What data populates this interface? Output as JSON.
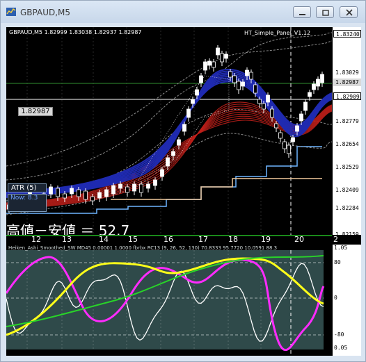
{
  "window": {
    "title": "GBPAUD,M5"
  },
  "chart_header": {
    "symbol_text": "GBPAUD,M5  1.82999 1.83038 1.82937 1.82987",
    "indicator_name": "HT_Simple_Panel_V1.12"
  },
  "price_scale": {
    "labels": [
      "1.83240",
      "1.83029",
      "1.82987",
      "1.82909",
      "1.82779",
      "1.82654",
      "1.82529",
      "1.82409",
      "1.82284",
      "1.82159"
    ]
  },
  "bid_tag": "1.82987",
  "atr_panel": {
    "label": "ATR (5)",
    "value_text": "Now: 8.3"
  },
  "overlay_text": "高値－安値 ＝ 52.7",
  "time_axis": {
    "labels": [
      "12",
      "13",
      "14",
      "15",
      "16",
      "17",
      "18",
      "19",
      "20",
      "2"
    ]
  },
  "sub_window": {
    "header": "Heiken_Ashi_Smoothed_SW  MD45 0.00001  1.0000  fbrbx  RC13 (9, 26, 52, 130) 70.8333 95.7720 10.0591 88.3",
    "scale_labels": [
      "1.05",
      "80",
      "0",
      "-80",
      "0.05"
    ],
    "extra_label": "0.05"
  },
  "colors": {
    "background": "#000000",
    "bull_candle": "#ffffff",
    "ribbon_blue": "#1f2ab0",
    "ribbon_red": "#c0201a",
    "line_sky": "#6fb6ff",
    "line_tan": "#f0c79a",
    "osc_white": "#ffffff",
    "osc_magenta": "#ff2bff",
    "osc_yellow": "#ffff1a",
    "osc_green": "#28d428",
    "sub_background": "#2f4a4a"
  }
}
